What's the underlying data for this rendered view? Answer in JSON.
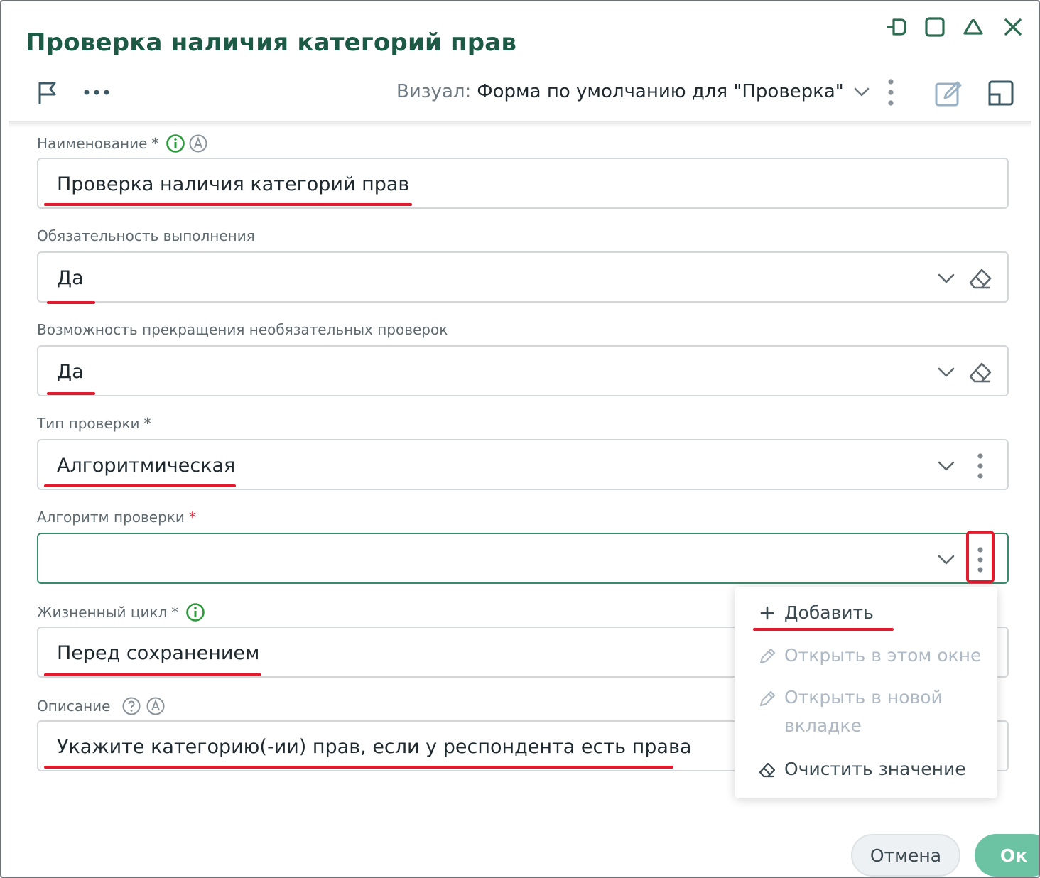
{
  "window": {
    "title": "Проверка наличия категорий прав"
  },
  "toolbar": {
    "visual_label": "Визуал:",
    "visual_value": "Форма по умолчанию для \"Проверка\""
  },
  "fields": {
    "name": {
      "label": "Наименование",
      "required_mark": "*",
      "value": "Проверка наличия категорий прав"
    },
    "mandatory": {
      "label": "Обязательность выполнения",
      "value": "Да"
    },
    "termination": {
      "label": "Возможность прекращения необязательных проверок",
      "value": "Да"
    },
    "check_type": {
      "label": "Тип проверки",
      "required_mark": "*",
      "value": "Алгоритмическая"
    },
    "algorithm": {
      "label": "Алгоритм проверки",
      "required_mark": "*",
      "value": ""
    },
    "lifecycle": {
      "label": "Жизненный цикл",
      "required_mark": "*",
      "value": "Перед сохранением"
    },
    "description": {
      "label": "Описание",
      "value": "Укажите категорию(-ии) прав, если у респондента есть права"
    }
  },
  "context_menu": {
    "items": [
      {
        "label": "Добавить",
        "enabled": true
      },
      {
        "label": "Открыть в этом окне",
        "enabled": false
      },
      {
        "label_line1": "Открыть в новой",
        "label_line2": "вкладке",
        "enabled": false
      },
      {
        "label": "Очистить значение",
        "enabled": true
      }
    ]
  },
  "buttons": {
    "cancel": "Отмена",
    "ok": "Ок"
  },
  "colors": {
    "title_green": "#1d5a45",
    "accent_green": "#2e7d5b",
    "ok_button": "#6cc3a3",
    "highlight_red": "#e3192d",
    "disabled_text": "#aeb9c4"
  }
}
